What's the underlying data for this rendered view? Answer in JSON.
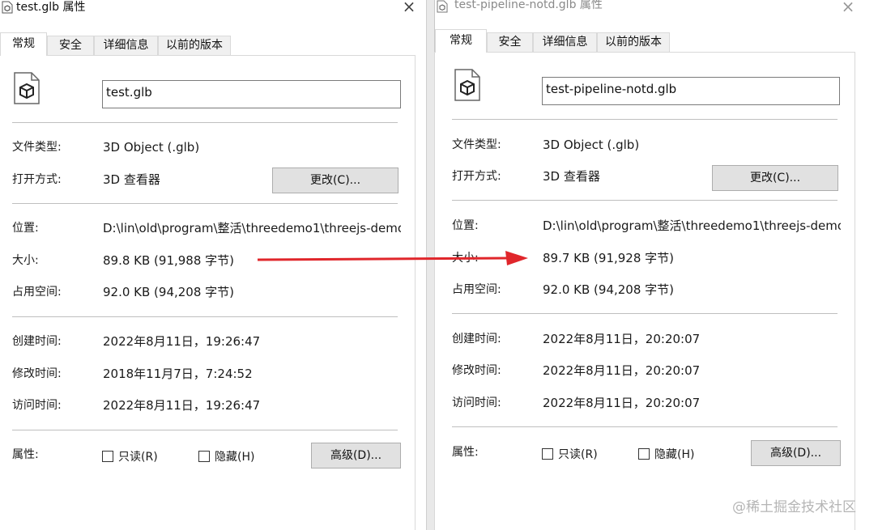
{
  "left": {
    "title": "test.glb 属性",
    "close": "×",
    "tabs": [
      "常规",
      "安全",
      "详细信息",
      "以前的版本"
    ],
    "filename": "test.glb",
    "type_label": "文件类型:",
    "type_value": "3D Object (.glb)",
    "open_label": "打开方式:",
    "open_value": "3D 查看器",
    "change_button": "更改(C)...",
    "location_label": "位置:",
    "location_value": "D:\\lin\\old\\program\\整活\\threedemo1\\threejs-demo",
    "size_label": "大小:",
    "size_value": "89.8 KB (91,988 字节)",
    "disk_label": "占用空间:",
    "disk_value": "92.0 KB (94,208 字节)",
    "created_label": "创建时间:",
    "created_value": "2022年8月11日，19:26:47",
    "modified_label": "修改时间:",
    "modified_value": "2018年11月7日，7:24:52",
    "accessed_label": "访问时间:",
    "accessed_value": "2022年8月11日，19:26:47",
    "attributes_label": "属性:",
    "readonly_label": "只读(R)",
    "hidden_label": "隐藏(H)",
    "advanced_button": "高级(D)..."
  },
  "right": {
    "title": "test-pipeline-notd.glb 属性",
    "close": "×",
    "tabs": [
      "常规",
      "安全",
      "详细信息",
      "以前的版本"
    ],
    "filename": "test-pipeline-notd.glb",
    "type_label": "文件类型:",
    "type_value": "3D Object (.glb)",
    "open_label": "打开方式:",
    "open_value": "3D 查看器",
    "change_button": "更改(C)...",
    "location_label": "位置:",
    "location_value": "D:\\lin\\old\\program\\整活\\threedemo1\\threejs-demo",
    "size_label": "大小:",
    "size_value": "89.7 KB (91,928 字节)",
    "disk_label": "占用空间:",
    "disk_value": "92.0 KB (94,208 字节)",
    "created_label": "创建时间:",
    "created_value": "2022年8月11日，20:20:07",
    "modified_label": "修改时间:",
    "modified_value": "2022年8月11日，20:20:07",
    "accessed_label": "访问时间:",
    "accessed_value": "2022年8月11日，20:20:07",
    "attributes_label": "属性:",
    "readonly_label": "只读(R)",
    "hidden_label": "隐藏(H)",
    "advanced_button": "高级(D)..."
  },
  "watermark": "@稀土掘金技术社区",
  "colors": {
    "arrow": "#e0262b",
    "button_bg": "#e1e1e1",
    "separator": "#bfbfbf"
  }
}
